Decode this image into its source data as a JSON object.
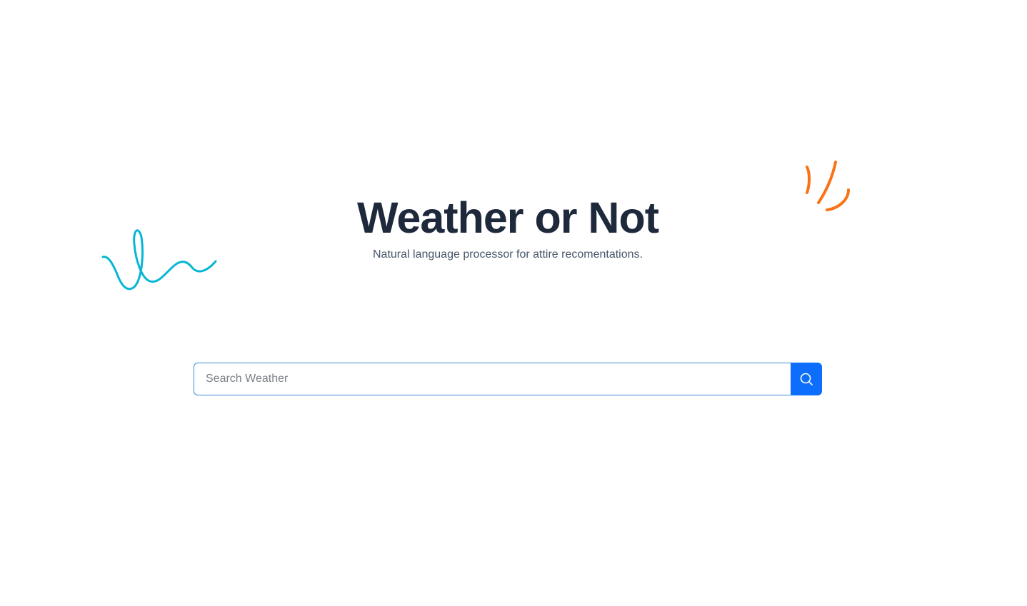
{
  "hero": {
    "title": "Weather or Not",
    "subtitle": "Natural language processor for attire recomentations."
  },
  "search": {
    "placeholder": "Search Weather",
    "value": "",
    "button_icon": "search-icon"
  },
  "colors": {
    "title": "#1e293b",
    "subtitle": "#475569",
    "accent": "#0d6efd",
    "input_border": "#3b8ed8",
    "squiggle_left": "#06b6d4",
    "squiggle_right": "#f97316"
  }
}
